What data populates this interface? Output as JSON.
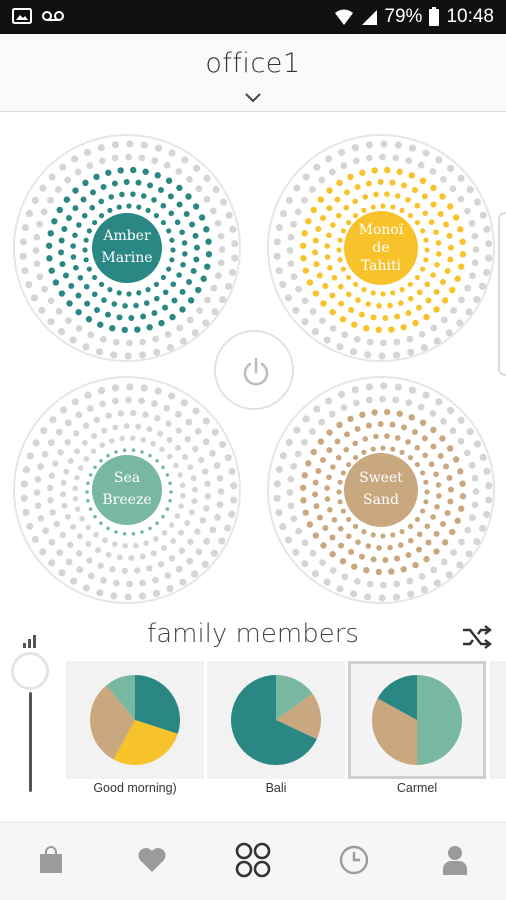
{
  "status_bar": {
    "battery": "79%",
    "time": "10:48"
  },
  "header": {
    "title": "office1"
  },
  "diffusers": [
    {
      "name_lines": [
        "Amber",
        "Marine"
      ],
      "color": "#2a8783",
      "style": "dense"
    },
    {
      "name_lines": [
        "Monoï",
        "de",
        "Tahiti"
      ],
      "color": "#f8c22b",
      "style": "dense"
    },
    {
      "name_lines": [
        "Sea",
        "Breeze"
      ],
      "color": "#78b8a0",
      "style": "sparse"
    },
    {
      "name_lines": [
        "Sweet",
        "Sand"
      ],
      "color": "#c9a77f",
      "style": "dense"
    }
  ],
  "family": {
    "title": "family members",
    "cards": [
      {
        "label": "Good morning)",
        "slices": [
          {
            "color": "#2a8783",
            "value": 0.3
          },
          {
            "color": "#f8c22b",
            "value": 0.28
          },
          {
            "color": "#c9a77f",
            "value": 0.31
          },
          {
            "color": "#78b8a0",
            "value": 0.11
          }
        ]
      },
      {
        "label": "Bali",
        "slices": [
          {
            "color": "#78b8a0",
            "value": 0.15
          },
          {
            "color": "#c9a77f",
            "value": 0.17
          },
          {
            "color": "#2a8783",
            "value": 0.68
          }
        ]
      },
      {
        "label": "Carmel",
        "slices": [
          {
            "color": "#78b8a0",
            "value": 0.5
          },
          {
            "color": "#c9a77f",
            "value": 0.33
          },
          {
            "color": "#2a8783",
            "value": 0.17
          }
        ]
      }
    ]
  },
  "nav": [
    "shop-icon",
    "heart-icon",
    "diffusers-icon",
    "clock-icon",
    "user-icon"
  ],
  "colors": {
    "grey_dot": "#d5d5d5",
    "nav_icon": "#9b9b9b",
    "nav_active": "#333333"
  }
}
